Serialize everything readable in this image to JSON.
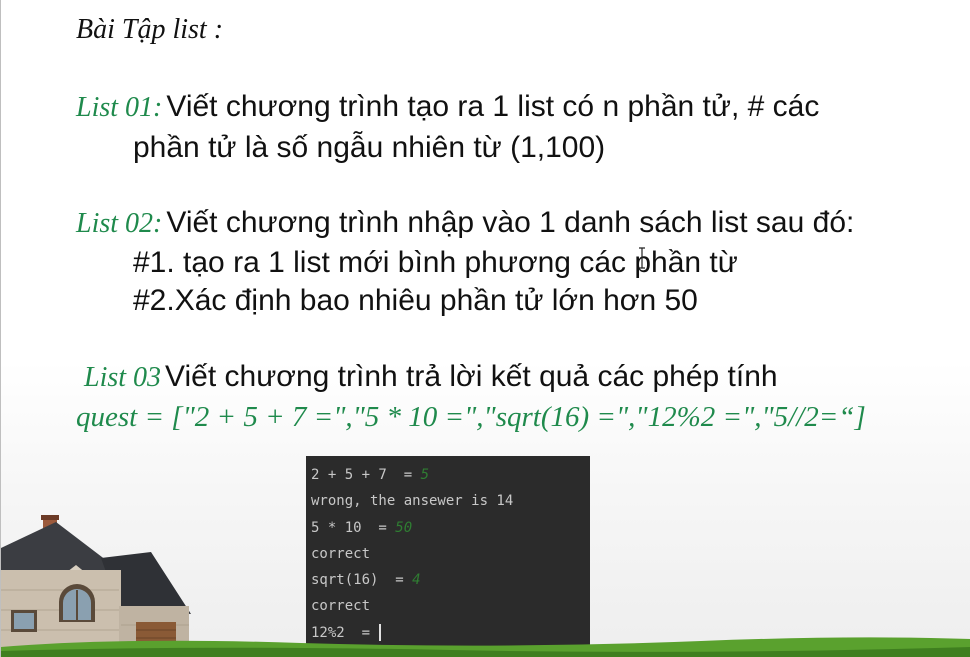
{
  "slide": {
    "title": "Bài Tập list :",
    "list01": {
      "tag": "List 01:",
      "line1": "Viết chương trình tạo ra 1 list có n phần tử, # các",
      "line2": "phần tử là số ngẫu nhiên từ (1,100)"
    },
    "list02": {
      "tag": "List 02:",
      "line1": "Viết chương trình nhập vào 1 danh sách list sau đó:",
      "line2": "#1. tạo ra 1 list mới bình phương các phần từ",
      "line3": "#2.Xác định bao nhiêu phần tử lớn hơn 50"
    },
    "list03": {
      "tag": "List 03",
      "line1": "Viết chương trình trả lời kết quả các phép tính",
      "quest": "quest = [\"2 + 5 + 7 =\",\"5 * 10 =\",\"sqrt(16) =\",\"12%2 =\",\"5//2=“]"
    }
  },
  "terminal": {
    "q1": "2 + 5 + 7  = ",
    "a1": "5",
    "r1": "wrong, the ansewer is 14",
    "q2": "5 * 10  = ",
    "a2": "50",
    "r2": "correct",
    "q3": "sqrt(16)  = ",
    "a3": "4",
    "r3": "correct",
    "q4": "12%2  = "
  },
  "colors": {
    "accent_green": "#1f8a4c",
    "terminal_bg": "#2b2b2b",
    "terminal_answer": "#2f7d32"
  },
  "icons": [
    "house-illustration",
    "text-cursor-icon",
    "grass-strip"
  ]
}
